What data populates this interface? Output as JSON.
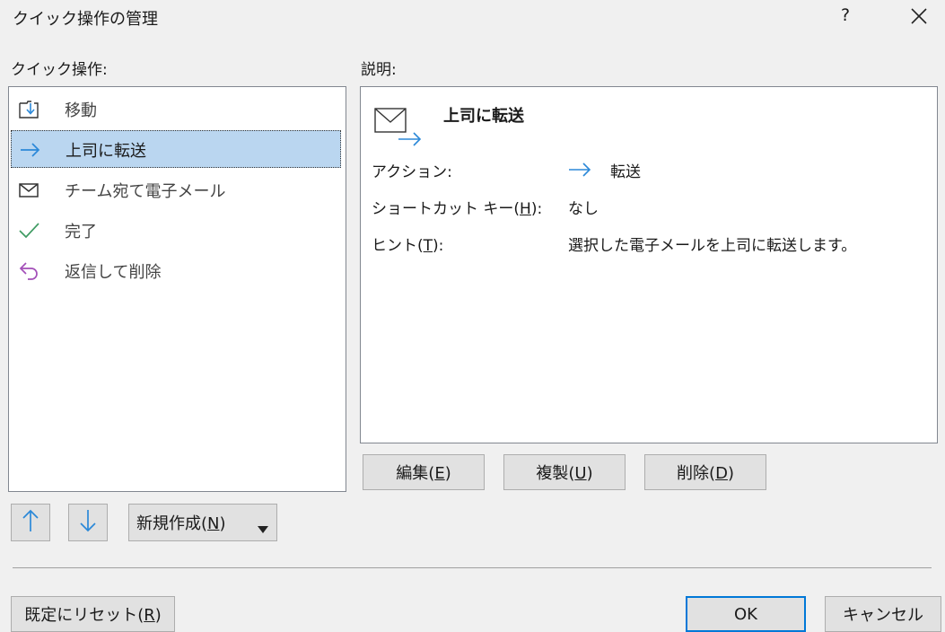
{
  "dialog": {
    "title": "クイック操作の管理",
    "help_label": "?"
  },
  "list": {
    "label": "クイック操作:",
    "items": [
      {
        "label": "移動",
        "icon": "move-to-folder-icon",
        "selected": false
      },
      {
        "label": "上司に転送",
        "icon": "forward-arrow-icon",
        "selected": true
      },
      {
        "label": "チーム宛て電子メール",
        "icon": "envelope-icon",
        "selected": false
      },
      {
        "label": "完了",
        "icon": "checkmark-icon",
        "selected": false
      },
      {
        "label": "返信して削除",
        "icon": "reply-icon",
        "selected": false
      }
    ]
  },
  "description": {
    "label": "説明:",
    "heading": "上司に転送",
    "action_label": "アクション:",
    "action_value": "転送",
    "shortcut_label": "ショートカット キー(",
    "shortcut_mnemonic": "H",
    "shortcut_suffix": "):",
    "shortcut_value": "なし",
    "hint_label": "ヒント(",
    "hint_mnemonic": "T",
    "hint_suffix": "):",
    "hint_value": "選択した電子メールを上司に転送します。"
  },
  "actions": {
    "edit": {
      "label": "編集(",
      "mnemonic": "E",
      "suffix": ")"
    },
    "duplicate": {
      "label": "複製(",
      "mnemonic": "U",
      "suffix": ")"
    },
    "delete": {
      "label": "削除(",
      "mnemonic": "D",
      "suffix": ")"
    }
  },
  "list_controls": {
    "new": {
      "label": "新規作成(",
      "mnemonic": "N",
      "suffix": ")"
    }
  },
  "footer": {
    "reset": {
      "label": "既定にリセット(",
      "mnemonic": "R",
      "suffix": ")"
    },
    "ok_label": "OK",
    "cancel_label": "キャンセル"
  },
  "colors": {
    "accent_blue": "#2b88d8",
    "check_green": "#3f9b63",
    "reply_purple": "#a34fb8",
    "selection": "#bad6f0"
  }
}
